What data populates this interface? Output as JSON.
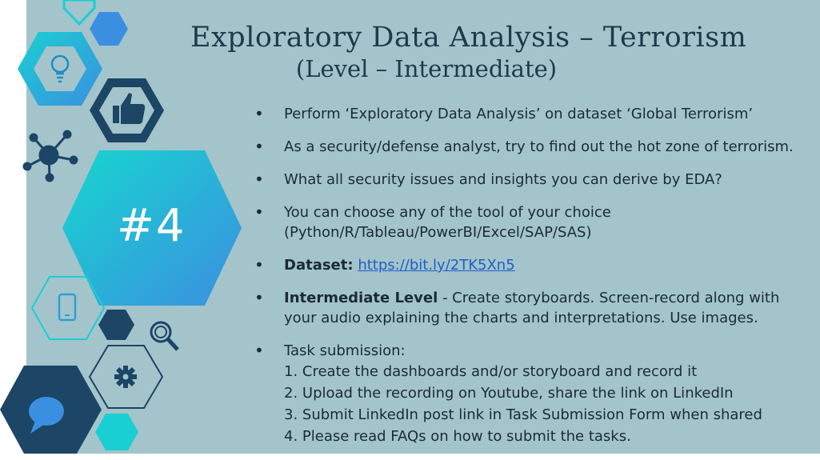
{
  "title": {
    "line1": "Exploratory Data Analysis – Terrorism",
    "line2": "(Level – Intermediate)"
  },
  "badge": "#4",
  "bullets": {
    "b1": "Perform ‘Exploratory Data Analysis’ on dataset  ‘Global Terrorism’",
    "b2": "As a security/defense analyst, try to find out the hot zone of terrorism.",
    "b3": "What all security issues and insights you can derive by EDA?",
    "b4_line1": "You can choose any of the tool of your choice",
    "b4_line2": "(Python/R/Tableau/PowerBI/Excel/SAP/SAS)",
    "b5_label": "Dataset:",
    "b5_link": "https://bit.ly/2TK5Xn5",
    "b6_label": "Intermediate Level",
    "b6_text1": " - Create storyboards. Screen-record along with",
    "b6_text2": "your audio explaining the charts and interpretations. Use images.",
    "b7_label": "Task submission:",
    "b7_steps": [
      "1. Create the dashboards and/or storyboard and record it",
      "2. Upload the recording on Youtube, share the link on LinkedIn",
      "3. Submit LinkedIn post link in Task Submission Form when shared",
      "4. Please read FAQs on how to submit the tasks."
    ]
  },
  "icons": [
    "lightbulb-icon",
    "thumbs-up-icon",
    "network-icon",
    "mobile-phone-icon",
    "magnifier-icon",
    "gear-icon",
    "chat-bubble-icon"
  ],
  "colors": {
    "background": "#a3c4ca",
    "title": "#1e3a4a",
    "navy": "#1c4566",
    "cyan": "#19cfd4",
    "blue": "#3b8fe0",
    "link": "#1f5fc8"
  }
}
